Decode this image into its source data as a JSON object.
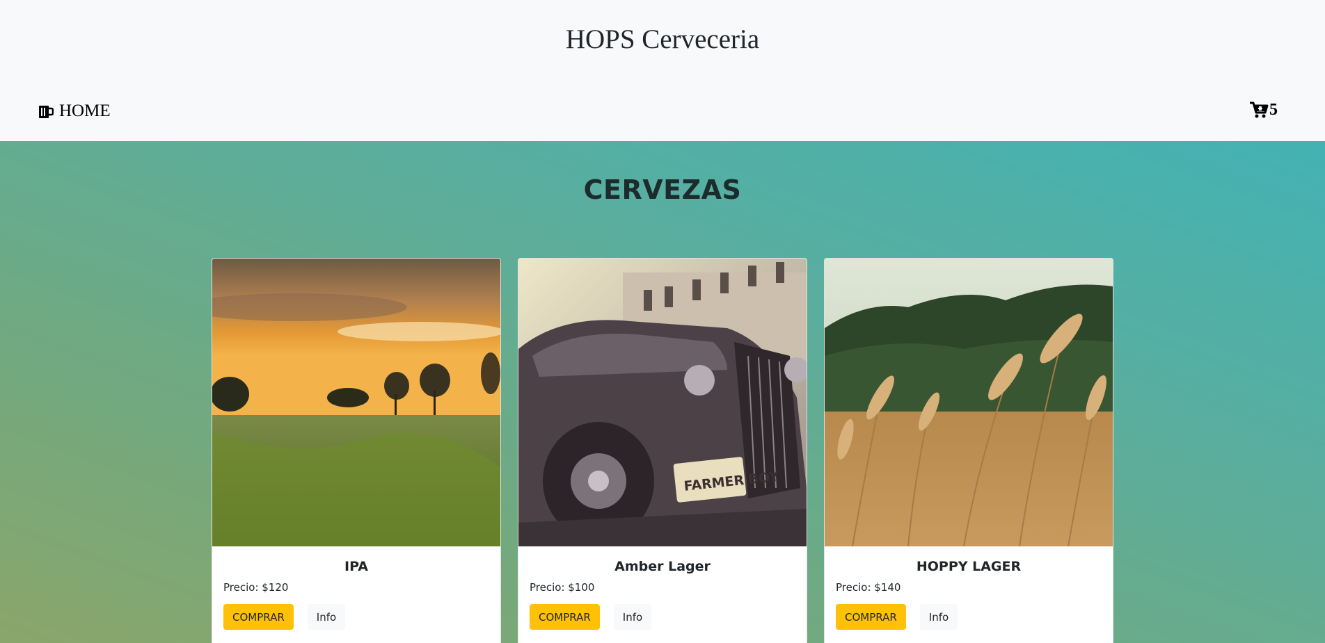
{
  "header": {
    "brand": "HOPS Cerveceria",
    "nav_home": {
      "label": "HOME",
      "icon": "beer-mug-icon"
    },
    "cart": {
      "icon": "cart-icon",
      "count": "5"
    }
  },
  "main": {
    "section_title": "CERVEZAS",
    "products": [
      {
        "name": "IPA",
        "price": "Precio: $120",
        "buy_label": "COMPRAR",
        "info_label": "Info",
        "image": "sunset-field-photo"
      },
      {
        "name": "Amber Lager",
        "price": "Precio: $100",
        "buy_label": "COMPRAR",
        "info_label": "Info",
        "image": "vintage-car-photo",
        "plate_text": "FARMER BOY"
      },
      {
        "name": "HOPPY LAGER",
        "price": "Precio: $140",
        "buy_label": "COMPRAR",
        "info_label": "Info",
        "image": "wheat-field-photo"
      }
    ]
  },
  "colors": {
    "buy_button": "#ffc107",
    "header_bg": "#f8f9fa",
    "gradient_top": "#43b2b3",
    "gradient_bottom": "#8aa66b"
  }
}
